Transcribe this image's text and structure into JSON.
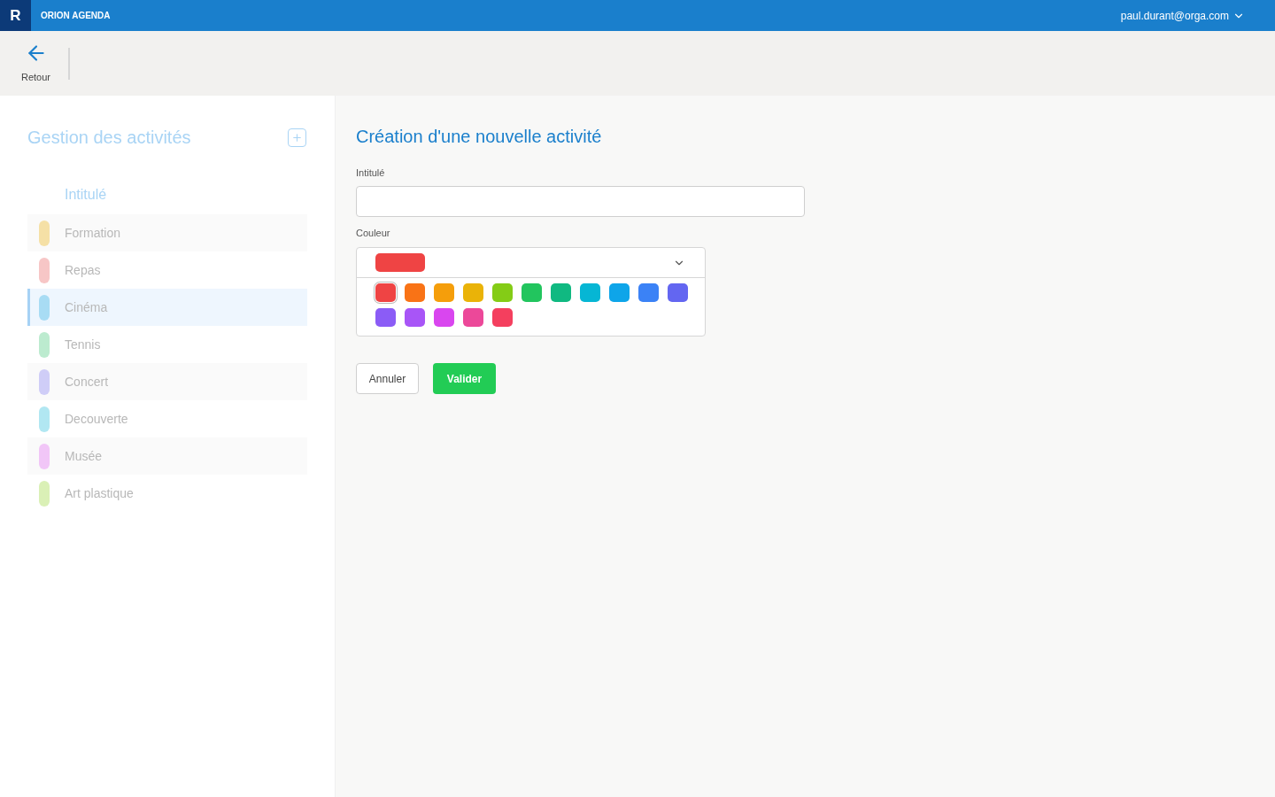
{
  "header": {
    "logo": "R",
    "app_name": "ORION AGENDA",
    "user": "paul.durant@orga.com"
  },
  "toolbar": {
    "back_label": "Retour"
  },
  "sidebar": {
    "title": "Gestion des activités",
    "column_header": "Intitulé",
    "items": [
      {
        "label": "Formation",
        "color": "#f5e0a6",
        "selected": false
      },
      {
        "label": "Repas",
        "color": "#f7c6c6",
        "selected": false
      },
      {
        "label": "Cinéma",
        "color": "#a8dcf4",
        "selected": true
      },
      {
        "label": "Tennis",
        "color": "#bcebcf",
        "selected": false
      },
      {
        "label": "Concert",
        "color": "#cfcdf7",
        "selected": false
      },
      {
        "label": "Decouverte",
        "color": "#b1e7f2",
        "selected": false
      },
      {
        "label": "Musée",
        "color": "#f1c6f7",
        "selected": false
      },
      {
        "label": "Art plastique",
        "color": "#daf0b6",
        "selected": false
      }
    ]
  },
  "form": {
    "title": "Création d'une nouvelle activité",
    "name_label": "Intitulé",
    "color_label": "Couleur",
    "swatches": [
      {
        "color": "#ef4444",
        "selected": true
      },
      {
        "color": "#f97316",
        "selected": false
      },
      {
        "color": "#f59e0b",
        "selected": false
      },
      {
        "color": "#eab308",
        "selected": false
      },
      {
        "color": "#84cc16",
        "selected": false
      },
      {
        "color": "#22c55e",
        "selected": false
      },
      {
        "color": "#10b981",
        "selected": false
      },
      {
        "color": "#06b6d4",
        "selected": false
      },
      {
        "color": "#0ea5e9",
        "selected": false
      },
      {
        "color": "#3b82f6",
        "selected": false
      },
      {
        "color": "#6366f1",
        "selected": false
      },
      {
        "color": "#8b5cf6",
        "selected": false
      },
      {
        "color": "#a855f7",
        "selected": false
      },
      {
        "color": "#d946ef",
        "selected": false
      },
      {
        "color": "#ec4899",
        "selected": false
      },
      {
        "color": "#f43f5e",
        "selected": false
      }
    ],
    "cancel": "Annuler",
    "submit": "Valider"
  }
}
